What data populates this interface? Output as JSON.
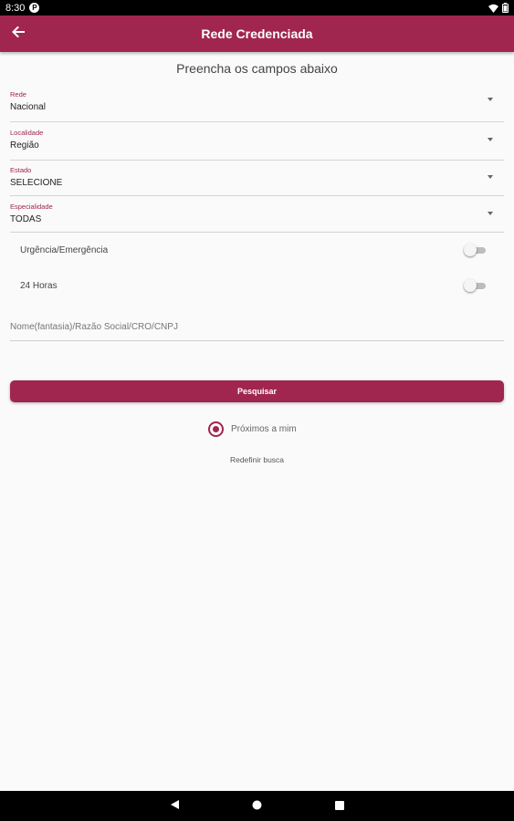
{
  "status_bar": {
    "time": "8:30",
    "app_icon_letter": "P"
  },
  "app_bar": {
    "title": "Rede Credenciada"
  },
  "form": {
    "subtitle": "Preencha os campos abaixo",
    "fields": [
      {
        "label": "Rede",
        "value": "Nacional"
      },
      {
        "label": "Localidade",
        "value": "Região"
      },
      {
        "label": "Estado",
        "value": "SELECIONE"
      },
      {
        "label": "Especialidade",
        "value": "TODAS"
      }
    ],
    "toggles": [
      {
        "label": "Urgência/Emergência",
        "on": false
      },
      {
        "label": "24 Horas",
        "on": false
      }
    ],
    "search": {
      "placeholder": "Nome(fantasia)/Razão Social/CRO/CNPJ",
      "value": ""
    },
    "search_button_label": "Pesquisar",
    "nearby": {
      "label": "Próximos a mim",
      "selected": true
    },
    "reset_label": "Redefinir busca"
  },
  "colors": {
    "primary": "#a0264f",
    "background": "#fafafa"
  },
  "icons": {
    "back": "arrow-back-icon",
    "wifi": "wifi-icon",
    "battery": "battery-icon",
    "nav_back": "nav-back-icon",
    "nav_home": "nav-home-icon",
    "nav_recents": "nav-recents-icon"
  }
}
